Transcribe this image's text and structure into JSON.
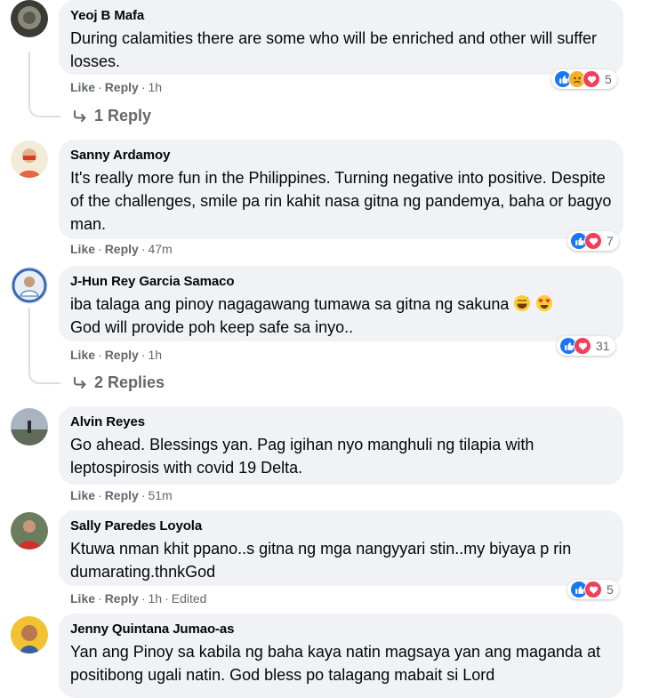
{
  "labels": {
    "like": "Like",
    "reply": "Reply",
    "dot": "·"
  },
  "comments": [
    {
      "name": "Yeoj B Mafa",
      "text": "During calamities there are some who will be enriched and other will suffer losses.",
      "time": "1h",
      "reactions": [
        "like",
        "sad",
        "love"
      ],
      "reaction_count": "5",
      "replies": "1 Reply"
    },
    {
      "name": "Sanny Ardamoy",
      "text": "It's really more fun in the Philippines. Turning negative into positive. Despite of the challenges, smile pa rin kahit nasa gitna ng pandemya, baha or bagyo man.",
      "time": "47m",
      "reactions": [
        "like",
        "love"
      ],
      "reaction_count": "7"
    },
    {
      "name": "J-Hun Rey Garcia Samaco",
      "text_line1": "iba talaga ang pinoy nagagawang tumawa sa gitna ng sakuna",
      "text_line2": "God will provide poh keep safe sa inyo..",
      "emojis": [
        "grinning-sweat-emoji",
        "heart-eyes-emoji"
      ],
      "time": "1h",
      "reactions": [
        "like",
        "love"
      ],
      "reaction_count": "31",
      "replies": "2 Replies"
    },
    {
      "name": "Alvin Reyes",
      "text": "Go ahead. Blessings yan. Pag igihan nyo manghuli ng tilapia with leptospirosis with covid 19 Delta.",
      "time": "51m"
    },
    {
      "name": "Sally Paredes Loyola",
      "text": "Ktuwa nman khit ppano..s gitna ng mga nangyyari stin..my biyaya p rin dumarating.thnkGod",
      "time": "1h",
      "edited": "Edited",
      "reactions": [
        "like",
        "love"
      ],
      "reaction_count": "5"
    },
    {
      "name": "Jenny Quintana Jumao-as",
      "text": "Yan ang Pinoy sa kabila ng baha kaya natin magsaya yan ang maganda at positibong ugali natin. God bless po talagang mabait si Lord"
    }
  ],
  "colors": {
    "like": "#1877f2",
    "love": "#f33e58",
    "sad": "#f7b125",
    "bubble": "#f0f2f5",
    "meta": "#65676b"
  }
}
